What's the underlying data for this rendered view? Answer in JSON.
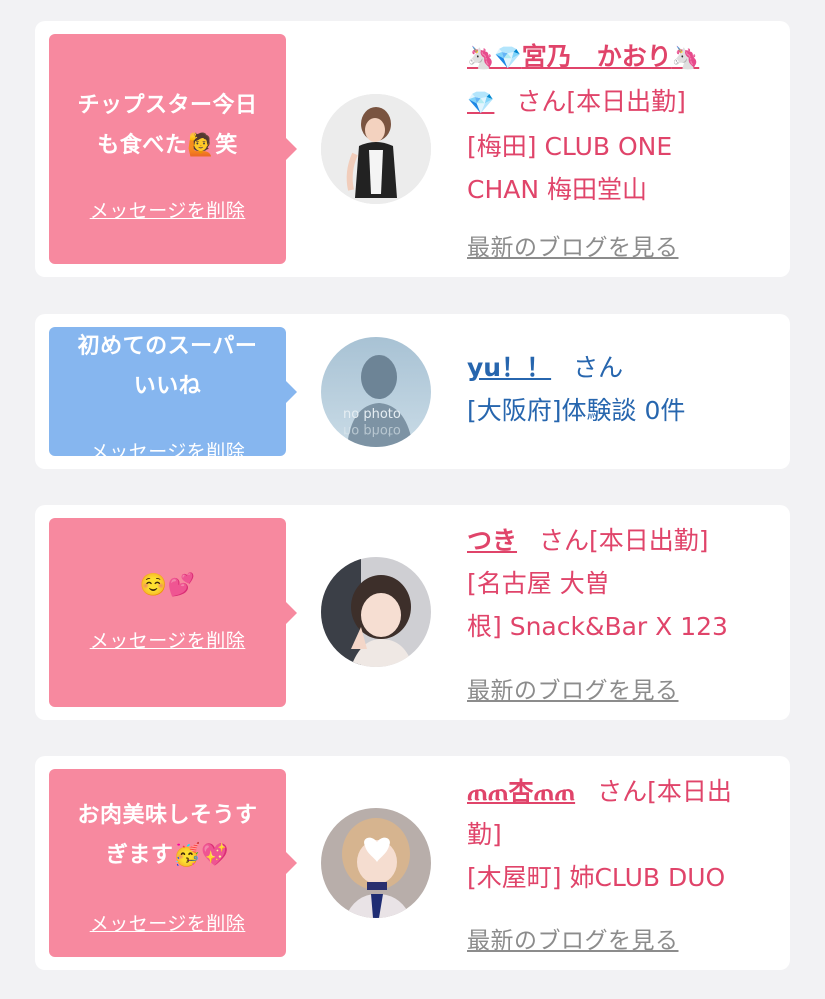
{
  "cards": [
    {
      "message_line1": "チップスター今日",
      "message_line2": "も食べた🙋笑",
      "delete_label": "メッセージを削除",
      "name_prefix": "🦄💎",
      "name": "宮乃　かおり",
      "name_suffix": "🦄",
      "name_line2": "💎",
      "san": "さん",
      "status": "[本日出勤]",
      "shop_line1": "[梅田] CLUB ONE",
      "shop_line2": "CHAN 梅田堂山",
      "blog_label": "最新のブログを見る"
    },
    {
      "message_line1": "初めてのスーパー",
      "message_line2": "いいね",
      "delete_label": "メッセージを削除",
      "name": "yu！！",
      "san": "さん",
      "shop_line1": "[大阪府]体験談 0件",
      "avatar_text": "no photo"
    },
    {
      "message_line1": "☺️💕",
      "delete_label": "メッセージを削除",
      "name": "つき",
      "san": "さん",
      "status": "[本日出勤]",
      "shop_line1": "[名古屋 大曽",
      "shop_line2": "根] Snack&Bar X 123",
      "blog_label": "最新のブログを見る"
    },
    {
      "message_line1": "お肉美味しそうす",
      "message_line2": "ぎます🥳💖",
      "delete_label": "メッセージを削除",
      "name": "ጠጠ杏ጠጠ",
      "san": "さん",
      "status_line1": "[本日出",
      "status_line2": "勤]",
      "shop_line1": "[木屋町] 姉CLUB DUO",
      "blog_label": "最新のブログを見る"
    }
  ],
  "colors": {
    "pink_bubble": "#f7899f",
    "blue_bubble": "#86b6ef",
    "pink_text": "#e0446a",
    "blue_text": "#2766ae",
    "blog_link": "#8c8c8c",
    "background": "#f2f2f4"
  }
}
